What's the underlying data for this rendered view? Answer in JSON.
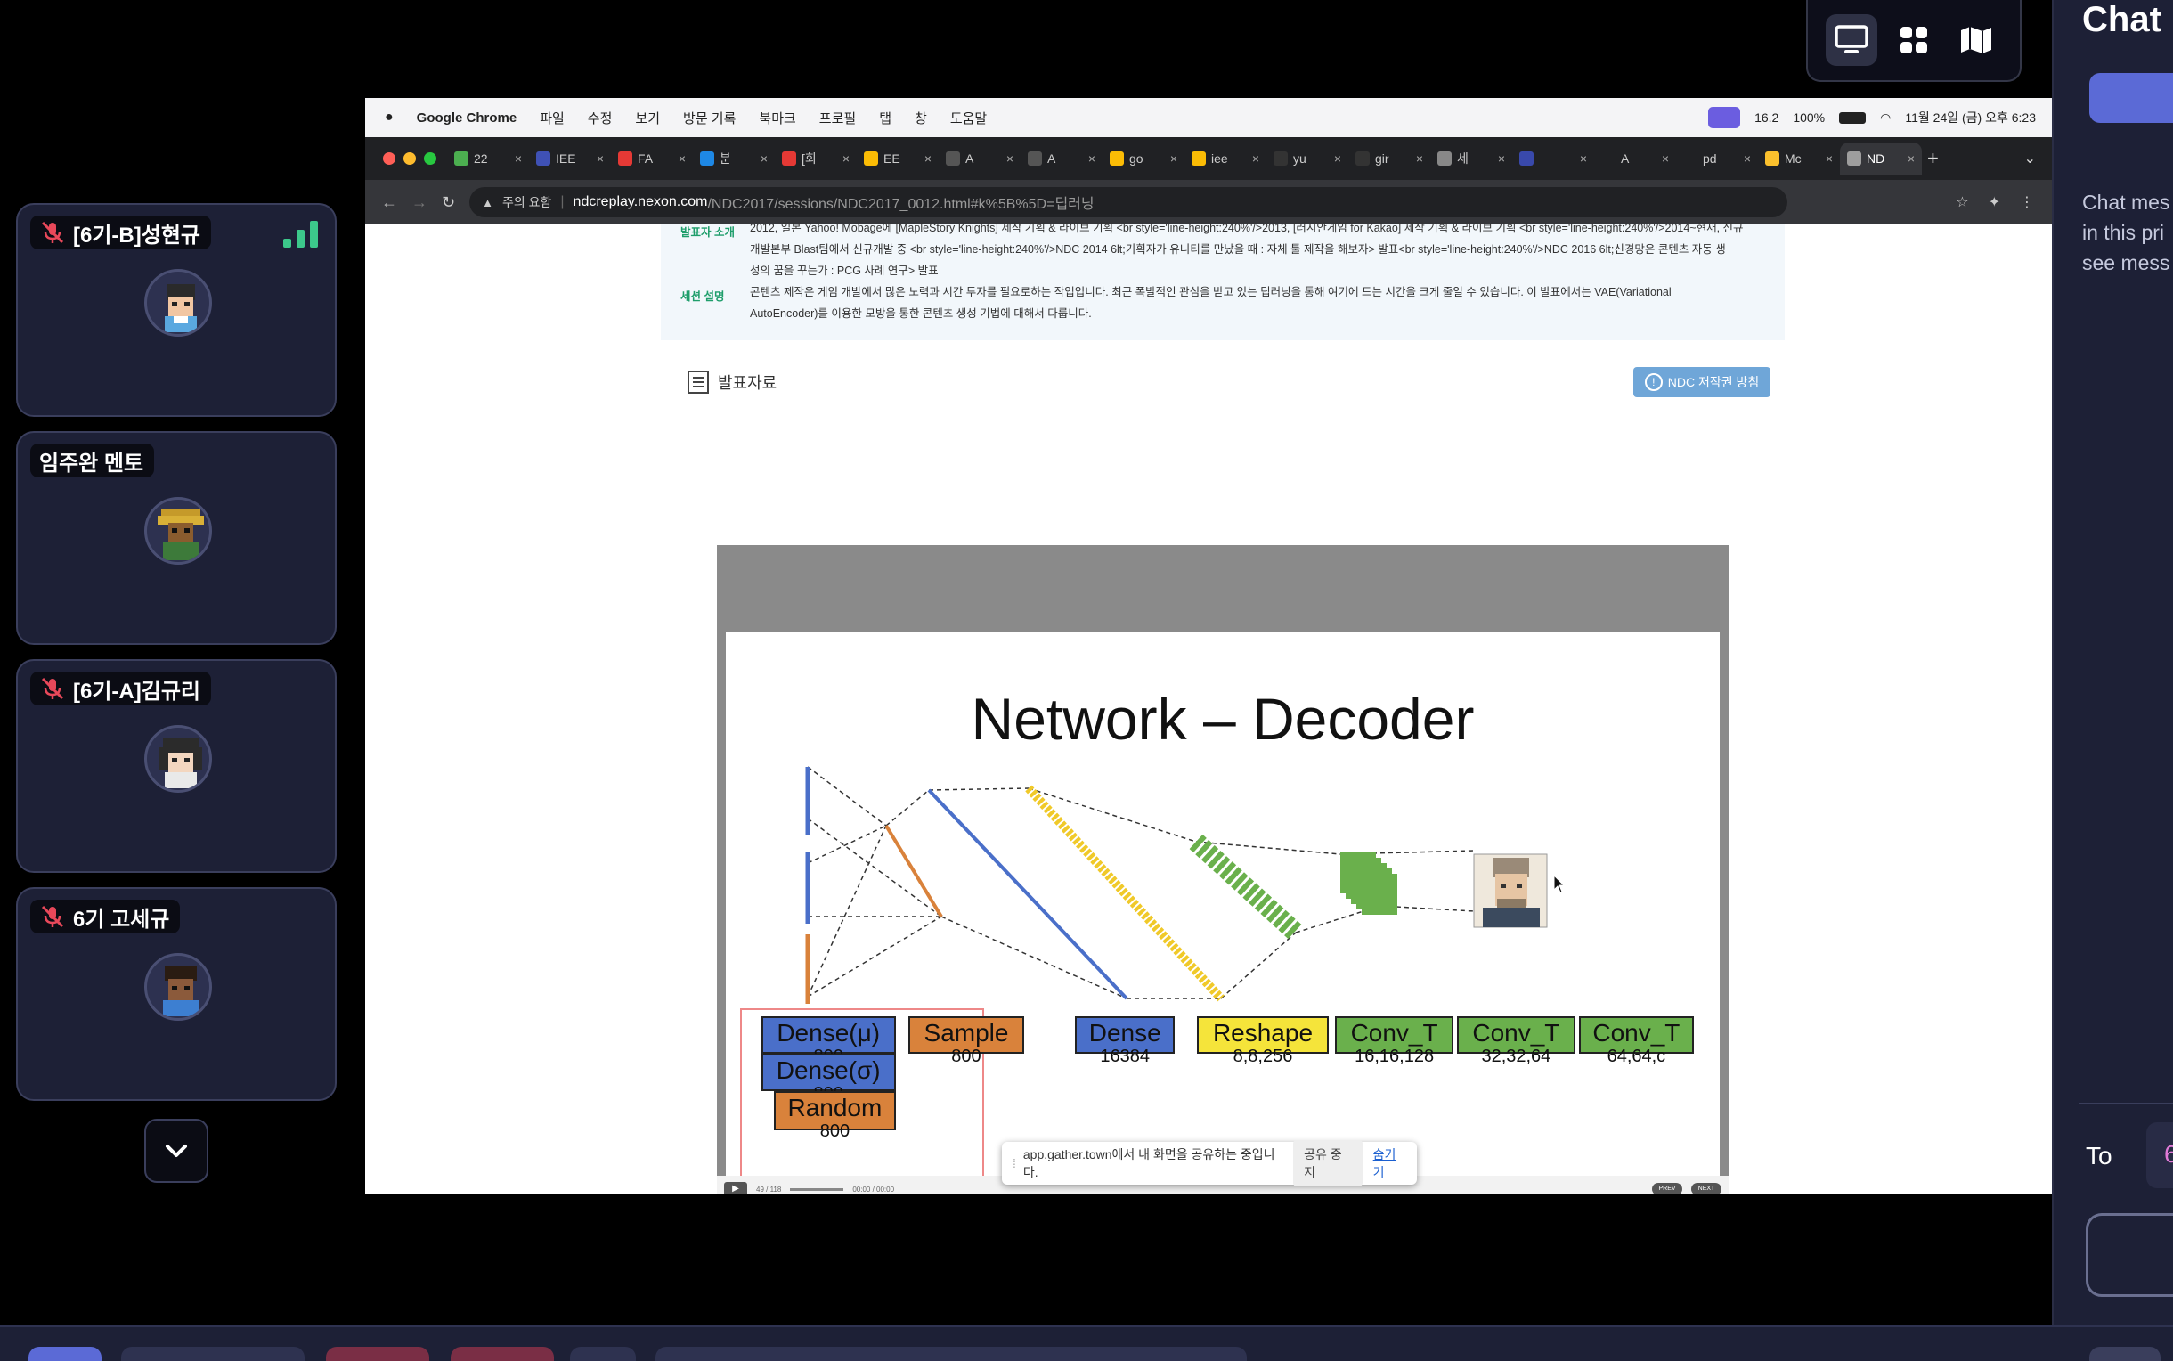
{
  "view_toggle": {
    "items": [
      "screen-share-view-icon",
      "grid-view-icon",
      "map-view-icon"
    ],
    "active": "screen-share-view-icon"
  },
  "participants": [
    {
      "name": "[6기-B]성현규",
      "muted": true,
      "signal": true
    },
    {
      "name": "임주완 멘토",
      "muted": false,
      "signal": false
    },
    {
      "name": "[6기-A]김규리",
      "muted": true,
      "signal": false
    },
    {
      "name": "6기 고세규",
      "muted": true,
      "signal": false
    }
  ],
  "mac_menu": {
    "app_name": "Google Chrome",
    "items": [
      "파일",
      "수정",
      "보기",
      "방문 기록",
      "북마크",
      "프로필",
      "탭",
      "창",
      "도움말"
    ],
    "status": {
      "cpu": "16.2",
      "battery": "100%",
      "datetime": "11월 24일 (금) 오후 6:23"
    }
  },
  "browser_tabs": [
    {
      "label": "22",
      "color": "#4caf50"
    },
    {
      "label": "IEE",
      "color": "#3f51b5"
    },
    {
      "label": "FA",
      "color": "#e53935"
    },
    {
      "label": "분",
      "color": "#1e88e5"
    },
    {
      "label": "[회",
      "color": "#e53935"
    },
    {
      "label": "EE",
      "color": "#fbbc05"
    },
    {
      "label": "A",
      "color": "#555"
    },
    {
      "label": "A",
      "color": "#555"
    },
    {
      "label": "go",
      "color": "#fbbc05"
    },
    {
      "label": "iee",
      "color": "#fbbc05"
    },
    {
      "label": "yu",
      "color": "#333"
    },
    {
      "label": "gir",
      "color": "#333"
    },
    {
      "label": "세",
      "color": "#888"
    },
    {
      "label": "",
      "color": "#3949ab"
    },
    {
      "label": "A",
      "color": "#202124"
    },
    {
      "label": "pd",
      "color": "#202124"
    },
    {
      "label": "Mc",
      "color": "#fbc02d"
    },
    {
      "label": "ND",
      "color": "#9e9e9e"
    }
  ],
  "address_bar": {
    "security": "주의 요함",
    "url_domain": "ndcreplay.nexon.com",
    "url_path": "/NDC2017/sessions/NDC2017_0012.html#k%5B%5D=딥러닝"
  },
  "session_info": {
    "speaker_label": "발표자 소개",
    "speaker_text_1": "2012, 일본 Yahoo! Mobage에 [MapleStory Knights] 제작 기획 & 라이브 기획 <br style='line-height:240%'/>2013, [러시안게임 for Kakao] 제작 기획 & 라이브 기획 <br style='line-height:240%'/>2014~현재, 신규",
    "speaker_text_2": "개발본부 Blast팀에서 신규개발 중 <br style='line-height:240%'/>NDC 2014 6lt;기획자가 유니티를 만났을 때 : 자체 툴 제작을 해보자> 발표<br style='line-height:240%'/>NDC 2016 6lt;신경망은 콘텐츠 자동 생",
    "speaker_text_3": "성의 꿈을 꾸는가 : PCG 사례 연구> 발표",
    "session_label": "세션 설명",
    "session_text_1": "콘텐츠 제작은 게임 개발에서 많은 노력과 시간 투자를 필요로하는 작업입니다. 최근 폭발적인 관심을 받고 있는 딥러닝을 통해 여기에 드는 시간을 크게 줄일 수 있습니다. 이 발표에서는 VAE(Variational",
    "session_text_2": "AutoEncoder)를 이용한 모방을 통한 콘텐츠 생성 기법에 대해서 다룹니다."
  },
  "materials": {
    "label": "발표자료",
    "copyright_button": "NDC 저작권 방침"
  },
  "slide": {
    "title": "Network – Decoder",
    "boxes": [
      {
        "name": "Dense(μ)",
        "sub": "800",
        "color": "#4a6fc9"
      },
      {
        "name": "Dense(σ)",
        "sub": "800",
        "color": "#4a6fc9"
      },
      {
        "name": "Random",
        "sub": "800",
        "color": "#d9823b"
      },
      {
        "name": "Sample",
        "sub": "800",
        "color": "#d9823b"
      },
      {
        "name": "Dense",
        "sub": "16384",
        "color": "#4a6fc9"
      },
      {
        "name": "Reshape",
        "sub": "8,8,256",
        "color": "#f5e43a"
      },
      {
        "name": "Conv_T",
        "sub": "16,16,128",
        "color": "#6ab04c"
      },
      {
        "name": "Conv_T",
        "sub": "32,32,64",
        "color": "#6ab04c"
      },
      {
        "name": "Conv_T",
        "sub": "64,64,c",
        "color": "#6ab04c"
      }
    ],
    "player": {
      "page": "49 / 118",
      "time": "00:00 / 00:00",
      "prev": "PREV",
      "next": "NEXT"
    }
  },
  "share_banner": {
    "message": "app.gather.town에서 내 화면을 공유하는 중입니다.",
    "stop": "공유 중지",
    "hide": "숨기기"
  },
  "chat": {
    "title": "Chat",
    "message_1": "Chat mes",
    "message_2": "in this pri",
    "message_3": "see mess",
    "to_label": "To",
    "to_value": "6"
  }
}
